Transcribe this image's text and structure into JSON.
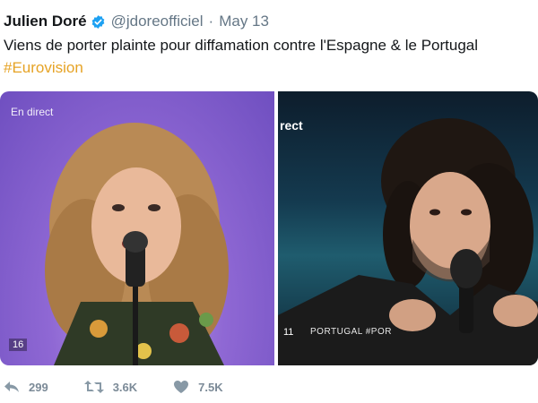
{
  "tweet": {
    "author_name": "Julien Doré",
    "handle": "@jdoreofficiel",
    "separator": "·",
    "date": "May 13",
    "text": "Viens de porter plainte pour diffamation contre l'Espagne & le Portugal",
    "hashtag": "#Eurovision"
  },
  "media": {
    "left": {
      "overlay_label": "En direct",
      "badge_number": "16"
    },
    "right": {
      "overlay_label": "rect",
      "badge_number": "11",
      "country_label": "PORTUGAL #POR"
    }
  },
  "actions": {
    "reply_count": "299",
    "retweet_count": "3.6K",
    "like_count": "7.5K"
  },
  "icons": {
    "verified": "verified-badge-icon",
    "reply": "reply-icon",
    "retweet": "retweet-icon",
    "like": "heart-icon"
  },
  "colors": {
    "hashtag": "#e6a325",
    "verified": "#1da1f2",
    "secondary_text": "#657786"
  }
}
